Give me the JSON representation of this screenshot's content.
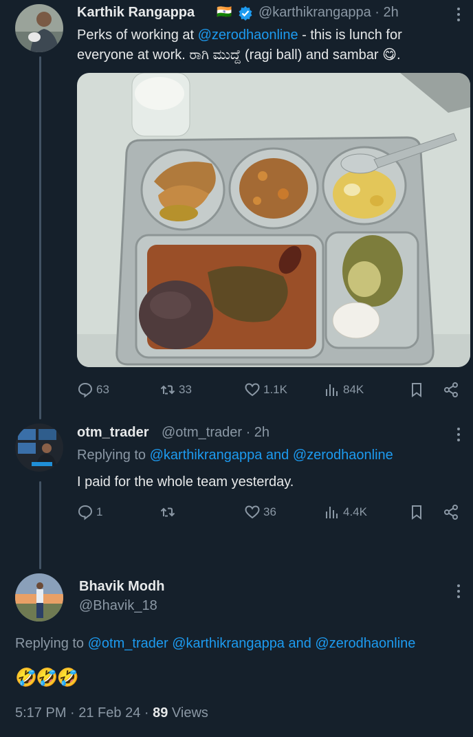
{
  "tweet1": {
    "name": "Karthik Rangappa",
    "flag": "🇮🇳",
    "handle": "@karthikrangappa",
    "time": "· 2h",
    "text_prefix": "Perks of working at ",
    "mention": "@zerodhaonline",
    "text_line1_rest": " - this is lunch for",
    "text_line2": "everyone at work. ರಾಗಿ ಮುದ್ದೆ (ragi ball) and sambar",
    "text_end": ".",
    "emoji": "😋",
    "stats": {
      "replies": "63",
      "reposts": "33",
      "likes": "1.1K",
      "views": "84K"
    }
  },
  "tweet2": {
    "name": "otm_trader",
    "handle": "@otm_trader",
    "time": "· 2h",
    "replying_prefix": "Replying to ",
    "replying_mention1": "@karthikrangappa",
    "replying_and": " and ",
    "replying_mention2": "@zerodhaonline",
    "text": "I paid for the whole team yesterday.",
    "stats": {
      "replies": "1",
      "reposts": "",
      "likes": "36",
      "views": "4.4K"
    }
  },
  "tweet3": {
    "name": "Bhavik Modh",
    "handle": "@Bhavik_18",
    "replying_prefix": "Replying to ",
    "replying_mention1": "@otm_trader",
    "replying_mention2": "@karthikrangappa",
    "replying_and": " and ",
    "replying_mention3": "@zerodhaonline",
    "emojis": "🤣🤣🤣",
    "timestamp": "5:17 PM · 21 Feb 24 · ",
    "views_count": "89",
    "views_label": " Views"
  },
  "colors": {
    "background": "#15202b",
    "accent": "#1d9bf0",
    "muted": "#8b98a5",
    "verified": "#1d9bf0"
  }
}
